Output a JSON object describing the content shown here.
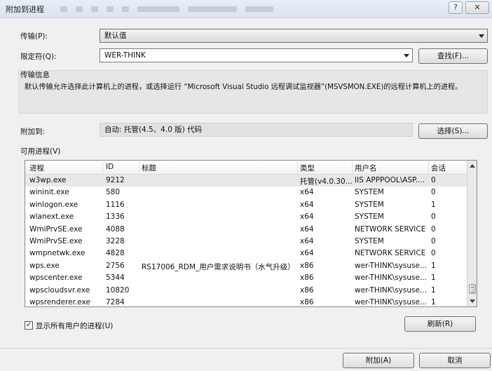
{
  "window": {
    "title": "附加到进程"
  },
  "transport": {
    "label": "传输(P):",
    "value": "默认值"
  },
  "qualifier": {
    "label": "限定符(Q):",
    "value": "WER-THINK",
    "find_button": "查找(F)..."
  },
  "transport_info": {
    "heading": "传输信息",
    "text": "默认传输允许选择此计算机上的进程，或选择运行 “Microsoft Visual Studio 远程调试监视器”(MSVSMON.EXE)的远程计算机上的进程。"
  },
  "attach_to": {
    "label": "附加到:",
    "value": "自动: 托管(4.5、4.0 版) 代码",
    "select_button": "选择(S)..."
  },
  "processes": {
    "label": "可用进程(V)",
    "columns": [
      "进程",
      "ID",
      "标题",
      "类型",
      "用户名",
      "会话"
    ],
    "rows": [
      [
        "w3wp.exe",
        "9212",
        "",
        "托管(v4.0.30...",
        "IIS APPPOOL\\ASP....",
        "0"
      ],
      [
        "wininit.exe",
        "580",
        "",
        "x64",
        "SYSTEM",
        "0"
      ],
      [
        "winlogon.exe",
        "1116",
        "",
        "x64",
        "SYSTEM",
        "1"
      ],
      [
        "wlanext.exe",
        "1336",
        "",
        "x64",
        "SYSTEM",
        "0"
      ],
      [
        "WmiPrvSE.exe",
        "4088",
        "",
        "x64",
        "NETWORK SERVICE",
        "0"
      ],
      [
        "WmiPrvSE.exe",
        "3228",
        "",
        "x64",
        "SYSTEM",
        "0"
      ],
      [
        "wmpnetwk.exe",
        "4828",
        "",
        "x64",
        "NETWORK SERVICE",
        "0"
      ],
      [
        "wps.exe",
        "2756",
        "RS17006_RDM_用户需求说明书（水气升级）...",
        "x86",
        "wer-THINK\\sysuse...",
        "1"
      ],
      [
        "wpscenter.exe",
        "5344",
        "",
        "x86",
        "wer-THINK\\sysuse...",
        "1"
      ],
      [
        "wpscloudsvr.exe",
        "10820",
        "",
        "x86",
        "wer-THINK\\sysuse...",
        "1"
      ],
      [
        "wpsrenderer.exe",
        "7284",
        "",
        "x86",
        "wer-THINK\\sysuse...",
        "1"
      ]
    ]
  },
  "show_all_users": {
    "label": "显示所有用户的进程(U)",
    "checked": true,
    "mark": "✓"
  },
  "buttons": {
    "refresh": "刷新(R)",
    "attach": "附加(A)",
    "cancel": "取消"
  },
  "titlebar": {
    "help": "?",
    "close": "✕"
  }
}
